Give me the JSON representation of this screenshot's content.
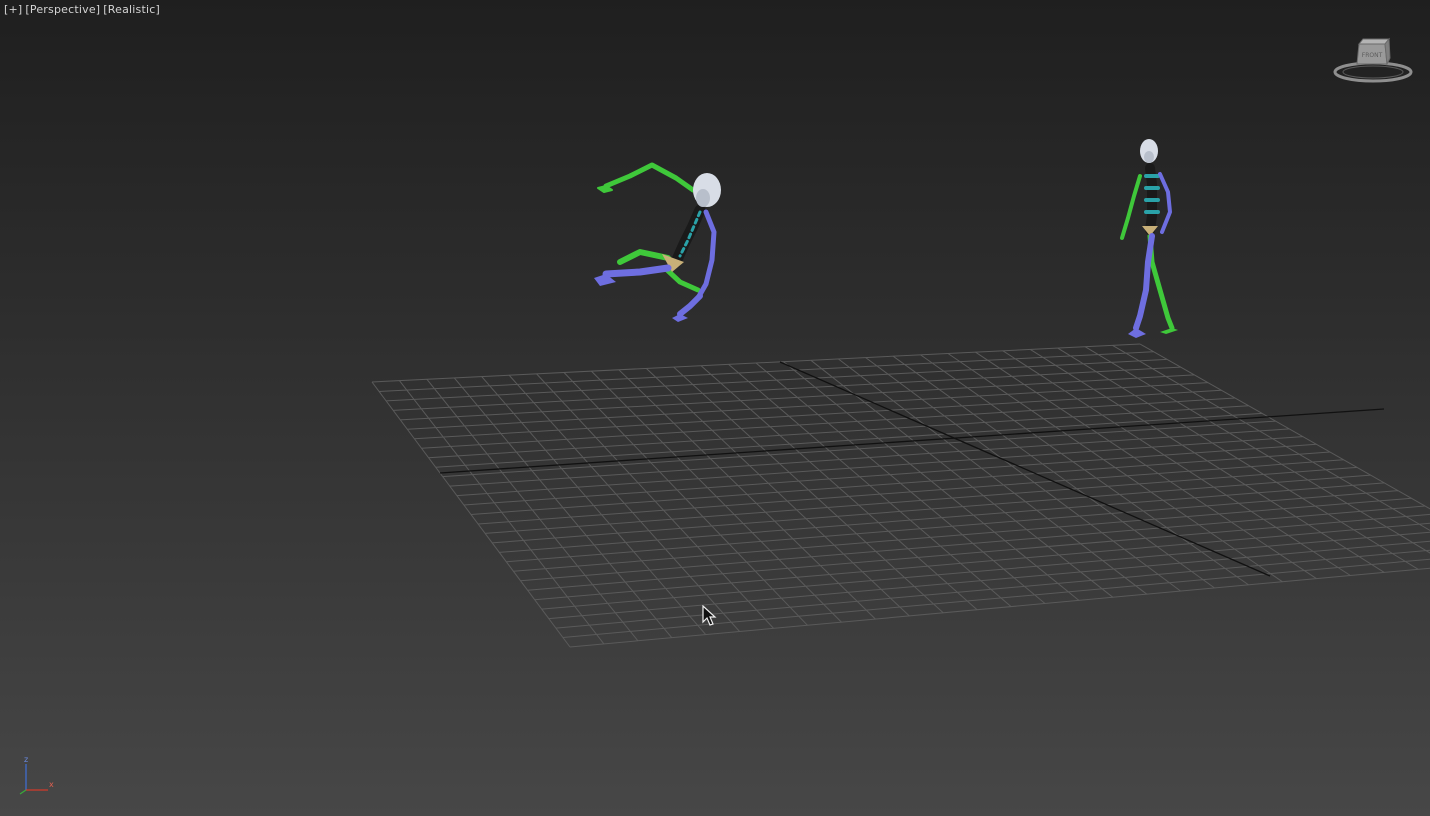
{
  "viewport": {
    "labels": {
      "plus": "[+]",
      "view": "[Perspective]",
      "shading": "[Realistic]"
    },
    "viewcube": {
      "face_label": "FRONT",
      "icon": "viewcube-icon"
    },
    "axis_tripod": {
      "z": "z",
      "x": "x",
      "icon": "axis-tripod-icon"
    },
    "colors": {
      "background_top": "#1f1f1f",
      "background_bottom": "#474747",
      "grid": "#5a5a5a",
      "grid_axis": "#111111",
      "biped_left": "#3fc83a",
      "biped_right": "#6e6ee0",
      "biped_head": "#d8dde6",
      "biped_spine": "#2aa2a8",
      "biped_pelvis": "#c8b078"
    },
    "cursor": {
      "icon": "mouse-pointer-icon"
    }
  }
}
